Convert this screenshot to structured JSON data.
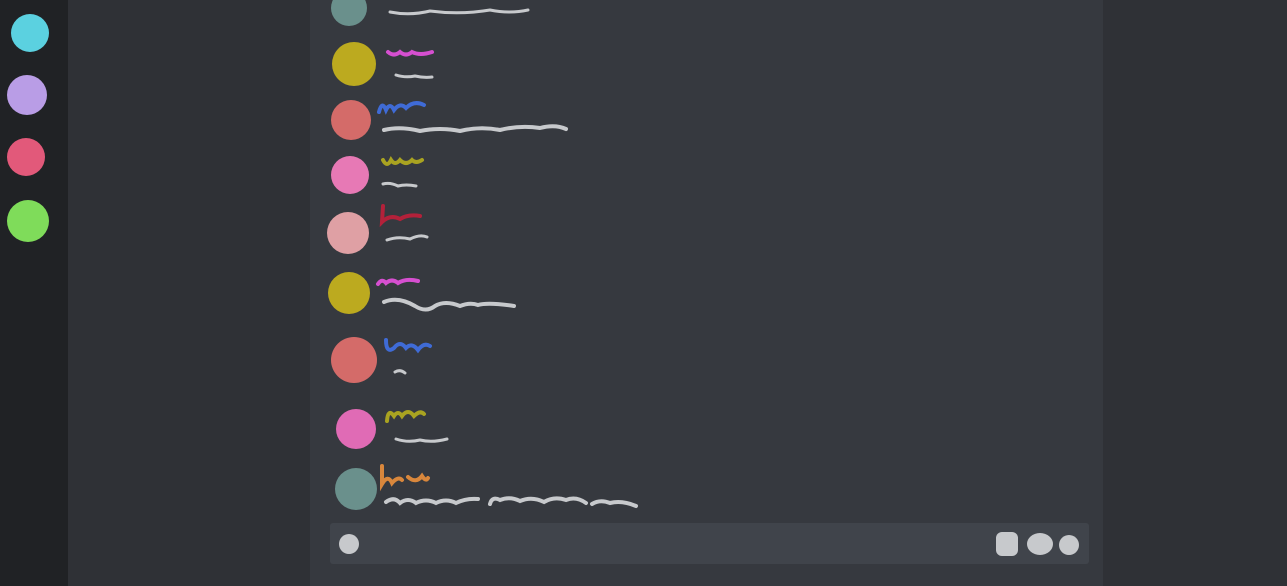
{
  "servers": [
    {
      "color": "#5bd1e0",
      "icon": "server-icon"
    },
    {
      "color": "#b99de6",
      "icon": "server-icon"
    },
    {
      "color": "#e2597a",
      "icon": "server-icon"
    },
    {
      "color": "#7fdc5a",
      "icon": "server-icon"
    }
  ],
  "colors": {
    "rail_bg": "#202225",
    "sidebar_bg": "#2f3136",
    "chat_bg": "#36393f",
    "composer_bg": "#40444b",
    "scribble_text": "#c7c9cc"
  },
  "messages": [
    {
      "avatar_color": "#6a908c",
      "name_color": "#c7c9cc"
    },
    {
      "avatar_color": "#bcaa1f",
      "name_color": "#d64fd0"
    },
    {
      "avatar_color": "#d46b69",
      "name_color": "#3f6bd6"
    },
    {
      "avatar_color": "#e779b5",
      "name_color": "#a9a321"
    },
    {
      "avatar_color": "#dfa0a4",
      "name_color": "#b3213a"
    },
    {
      "avatar_color": "#bcaa1f",
      "name_color": "#d64fd0"
    },
    {
      "avatar_color": "#d46b69",
      "name_color": "#3f6bd6"
    },
    {
      "avatar_color": "#e06bb5",
      "name_color": "#a9a321"
    },
    {
      "avatar_color": "#6a908c",
      "name_color": "#d9873c"
    }
  ],
  "composer": {
    "icons": [
      "attach-icon",
      "gift-icon",
      "gif-icon",
      "emoji-icon"
    ]
  }
}
